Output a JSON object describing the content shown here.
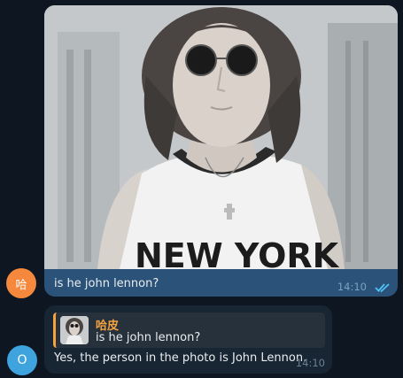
{
  "messages": [
    {
      "sender_avatar": "哈",
      "avatar_color": "#f5883c",
      "has_photo": true,
      "text": "is he john lennon?",
      "time": "14:10",
      "status": "double-check-icon"
    },
    {
      "sender_avatar": "O",
      "avatar_color": "#3fa3dd",
      "reply_to": {
        "author": "哈皮",
        "text": "is he john lennon?"
      },
      "text": "Yes, the person in the photo is John Lennon.",
      "time": "14:10"
    }
  ],
  "photo": {
    "shirt_text": "NEW YORK"
  },
  "colors": {
    "background": "#0e1621",
    "outgoing_bubble": "#2b5278",
    "incoming_bubble": "#182533",
    "quote_accent": "#f5a340",
    "check": "#4fc3f7"
  }
}
